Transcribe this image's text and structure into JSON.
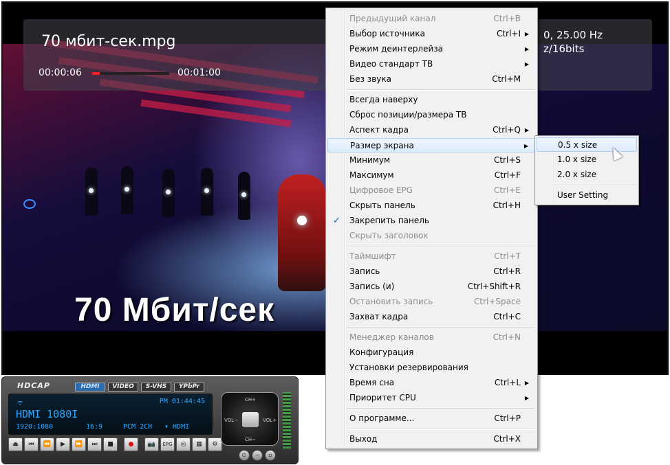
{
  "video": {
    "title": "70 мбит-сек.mpg",
    "time_current": "00:00:06",
    "time_total": "00:01:00",
    "progress": 0.1,
    "info_line1": "0, 25.00 Hz",
    "info_line2": "z/16bits",
    "overlay_text": "70 Мбит/сек"
  },
  "menu": {
    "items": [
      {
        "label": "Предыдущий канал",
        "shortcut": "Ctrl+B",
        "disabled": true
      },
      {
        "label": "Выбор источника",
        "shortcut": "Ctrl+I",
        "arrow": true
      },
      {
        "label": "Режим деинтерлейза",
        "arrow": true
      },
      {
        "label": "Видео стандарт ТВ",
        "arrow": true
      },
      {
        "label": "Без звука",
        "shortcut": "Ctrl+M"
      },
      {
        "label": "Всегда наверху"
      },
      {
        "label": "Сброс позиции/размера ТВ"
      },
      {
        "label": "Аспект кадра",
        "shortcut": "Ctrl+Q",
        "arrow": true
      },
      {
        "label": "Размер экрана",
        "arrow": true,
        "highlighted": true
      },
      {
        "label": "Минимум",
        "shortcut": "Ctrl+S"
      },
      {
        "label": "Максимум",
        "shortcut": "Ctrl+F"
      },
      {
        "label": "Цифровое EPG",
        "shortcut": "Ctrl+E",
        "disabled": true
      },
      {
        "label": "Скрыть панель",
        "shortcut": "Ctrl+H"
      },
      {
        "label": "Закрепить панель",
        "checked": true
      },
      {
        "label": "Скрыть заголовок",
        "disabled": true
      },
      {
        "label": "Таймшифт",
        "shortcut": "Ctrl+T",
        "disabled": true
      },
      {
        "label": "Запись",
        "shortcut": "Ctrl+R"
      },
      {
        "label": "Запись (и)",
        "shortcut": "Ctrl+Shift+R"
      },
      {
        "label": "Остановить запись",
        "shortcut": "Ctrl+Space",
        "disabled": true
      },
      {
        "label": "Захват кадра",
        "shortcut": "Ctrl+C"
      },
      {
        "label": "Менеджер каналов",
        "shortcut": "Ctrl+N",
        "disabled": true
      },
      {
        "label": "Конфигурация"
      },
      {
        "label": "Установки резервирования"
      },
      {
        "label": "Время сна",
        "shortcut": "Ctrl+L",
        "arrow": true
      },
      {
        "label": "Приоритет CPU",
        "arrow": true
      },
      {
        "label": "О программе...",
        "shortcut": "Ctrl+P"
      },
      {
        "label": "Выход",
        "shortcut": "Ctrl+X"
      }
    ],
    "check_glyph": "✓",
    "arrow_glyph": "▶"
  },
  "submenu": {
    "items": [
      {
        "label": "0.5 x size",
        "highlighted": true
      },
      {
        "label": "1.0 x size"
      },
      {
        "label": "2.0 x size"
      },
      {
        "label": "User Setting"
      }
    ]
  },
  "panel": {
    "logo": "HDCAP",
    "sources": [
      "HDMI",
      "VIDEO",
      "S-VHS",
      "YPbPr"
    ],
    "active_source": "HDMI",
    "lcd": {
      "clock": "PM 01:44:45",
      "main": "HDMI 1080I",
      "resolution": "1920:1080",
      "ratio": "16:9",
      "audio": "PCM 2CH",
      "output": "▾ HDMI",
      "signal_icon": "ᯤ"
    },
    "transport": [
      "⏏",
      "⏮",
      "⏪",
      "▶",
      "⏩",
      "⏭",
      "■",
      "●",
      "📷",
      "EPG",
      "◎",
      "▦",
      "⚙"
    ],
    "dpad": {
      "up": "CH+",
      "down": "CH−",
      "left": "VOL−",
      "right": "VOL+"
    },
    "window_buttons": [
      "⏻",
      "−",
      "▫"
    ]
  },
  "icons": {
    "cursor": "mouse-pointer-icon"
  }
}
